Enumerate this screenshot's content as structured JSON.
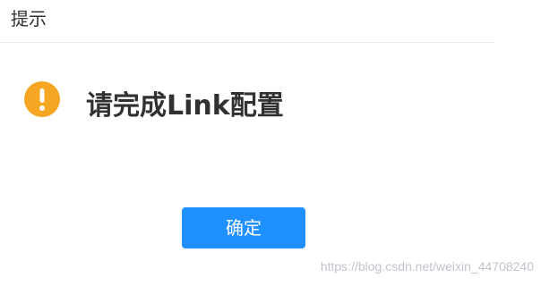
{
  "dialog": {
    "title": "提示",
    "message": "请完成Link配置",
    "icon": "warning-icon",
    "icon_color": "#f5a623",
    "confirm_label": "确定",
    "confirm_color": "#1e90ff"
  },
  "watermark": {
    "text": "https://blog.csdn.net/weixin_44708240"
  }
}
